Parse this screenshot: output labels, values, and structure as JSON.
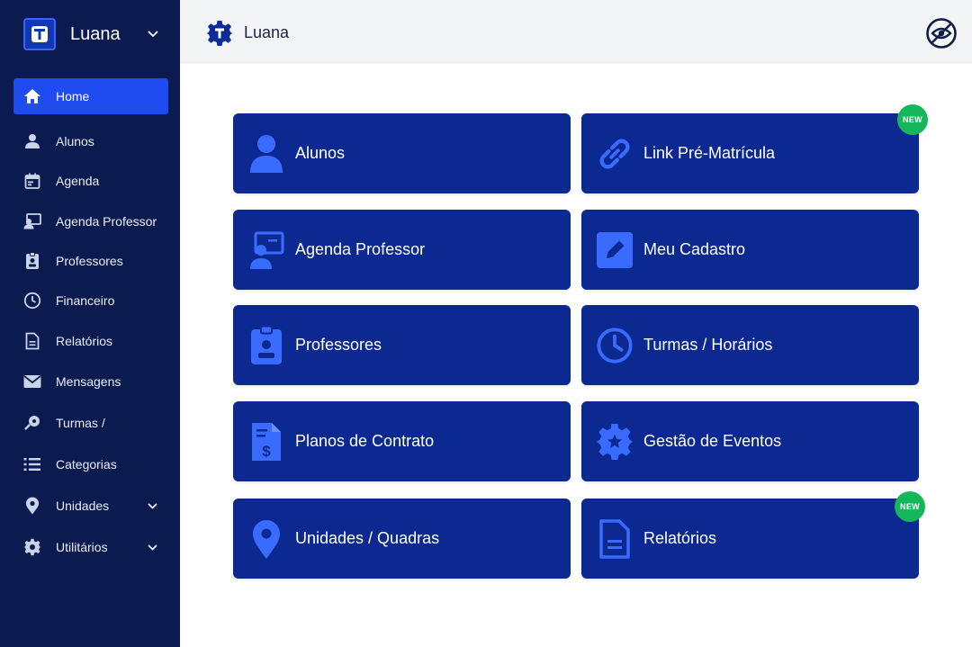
{
  "app": {
    "name": "Luana"
  },
  "sidebar": {
    "items": [
      {
        "label": "Home",
        "icon": "home-icon"
      },
      {
        "label": "Alunos",
        "icon": "user-icon"
      },
      {
        "label": "Agenda",
        "icon": "calendar-icon"
      },
      {
        "label": "Agenda Professor",
        "icon": "teacher-board-icon"
      },
      {
        "label": "Professores",
        "icon": "id-badge-icon"
      },
      {
        "label": "Financeiro",
        "icon": "clock-icon"
      },
      {
        "label": "Relatórios",
        "icon": "document-icon"
      },
      {
        "label": "Mensagens",
        "icon": "mail-icon"
      },
      {
        "label": "Turmas /",
        "icon": "whistle-icon"
      },
      {
        "label": "Categorias",
        "icon": "list-icon"
      },
      {
        "label": "Unidades",
        "icon": "location-pin-icon"
      },
      {
        "label": "Utilitários",
        "icon": "gear-icon"
      }
    ]
  },
  "header": {
    "title": "Luana"
  },
  "cards": [
    {
      "label": "Alunos",
      "icon": "user-icon"
    },
    {
      "label": "Link Pré-Matrícula",
      "icon": "link-icon",
      "badge": "NEW"
    },
    {
      "label": "Agenda Professor",
      "icon": "teacher-board-icon"
    },
    {
      "label": "Meu Cadastro",
      "icon": "edit-icon"
    },
    {
      "label": "Professores",
      "icon": "id-badge-icon"
    },
    {
      "label": "Turmas / Horários",
      "icon": "clock-icon"
    },
    {
      "label": "Planos de Contrato",
      "icon": "invoice-dollar-icon"
    },
    {
      "label": "Gestão de Eventos",
      "icon": "gear-star-icon"
    },
    {
      "label": "Unidades / Quadras",
      "icon": "location-pin-icon"
    },
    {
      "label": "Relatórios",
      "icon": "document-icon",
      "badge": "NEW"
    }
  ],
  "colors": {
    "sidebar_bg": "#0b1b4f",
    "active_item": "#1f4cf0",
    "card_bg": "#0c2891",
    "card_icon": "#3a6bff",
    "badge": "#16b65a"
  }
}
